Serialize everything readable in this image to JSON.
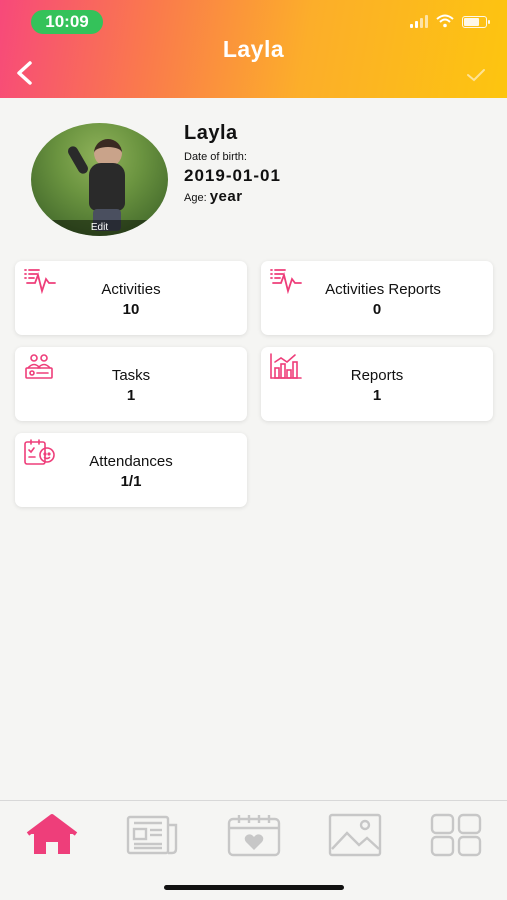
{
  "status_bar": {
    "time": "10:09"
  },
  "header": {
    "title": "Layla"
  },
  "profile": {
    "name": "Layla",
    "dob_label": "Date of birth:",
    "dob_value": "2019-01-01",
    "age_label": "Age:",
    "age_value": "year",
    "edit_label": "Edit"
  },
  "cards": [
    {
      "label": "Activities",
      "value": "10",
      "icon": "activity-pulse-icon"
    },
    {
      "label": "Activities Reports",
      "value": "0",
      "icon": "activity-report-icon"
    },
    {
      "label": "Tasks",
      "value": "1",
      "icon": "tasks-icon"
    },
    {
      "label": "Reports",
      "value": "1",
      "icon": "bar-chart-icon"
    },
    {
      "label": "Attendances",
      "value": "1/1",
      "icon": "attendance-icon"
    }
  ],
  "nav": [
    {
      "icon": "home-icon",
      "active": true
    },
    {
      "icon": "newspaper-icon",
      "active": false
    },
    {
      "icon": "calendar-heart-icon",
      "active": false
    },
    {
      "icon": "gallery-icon",
      "active": false
    },
    {
      "icon": "grid-icon",
      "active": false
    }
  ],
  "colors": {
    "accent": "#ee3e7a",
    "nav_inactive": "#c7c7c7",
    "header_start": "#f7497a",
    "header_end": "#fdc50f"
  }
}
